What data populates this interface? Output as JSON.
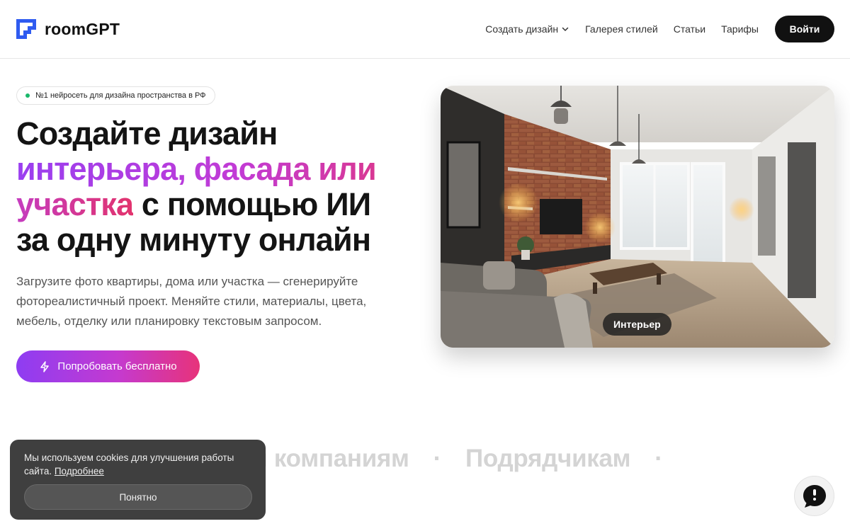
{
  "header": {
    "brand": "roomGPT",
    "nav": [
      {
        "label": "Создать дизайн",
        "has_dropdown": true
      },
      {
        "label": "Галерея стилей"
      },
      {
        "label": "Статьи"
      },
      {
        "label": "Тарифы"
      }
    ],
    "login_label": "Войти"
  },
  "hero": {
    "badge": "№1 нейросеть для дизайна пространства в РФ",
    "title_line1": "Создайте дизайн",
    "title_line2": "интерьера, фасада или",
    "title_line3_grad": "участка",
    "title_line3_rest": " с помощью ИИ",
    "title_line4": "за одну минуту онлайн",
    "description": "Загрузите фото квартиры, дома или участка — сгенерируйте фотореалистичный проект. Меняйте стили, материалы, цвета, мебель, отделку или планировку текстовым запросом.",
    "cta_label": "Попробовать бесплатно",
    "image_label": "Интерьер"
  },
  "marquee": {
    "items": [
      "оительным компаниям",
      "·",
      "Подрядчикам",
      "·"
    ]
  },
  "cookie": {
    "text": "Мы используем cookies для улучшения работы сайта. ",
    "link": "Подробнее",
    "button": "Понятно"
  },
  "colors": {
    "accent_start": "#8e3df2",
    "accent_end": "#e7337a",
    "brand_blue": "#2f5bf0",
    "dark": "#111111"
  },
  "icons": {
    "logo": "roomgpt-logo-icon",
    "dropdown": "chevron-down-icon",
    "cta": "lightning-icon",
    "chat": "chat-bubble-icon"
  }
}
